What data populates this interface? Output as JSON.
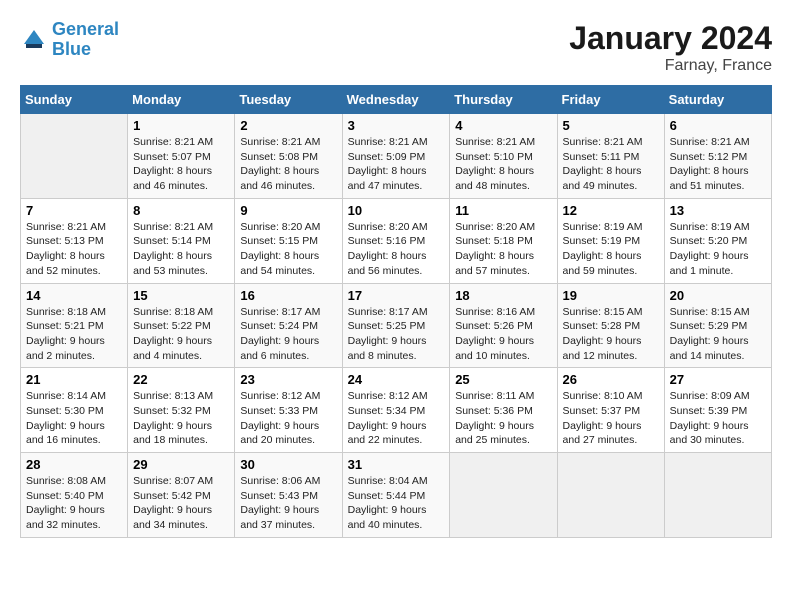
{
  "header": {
    "logo_line1": "General",
    "logo_line2": "Blue",
    "title": "January 2024",
    "subtitle": "Farnay, France"
  },
  "columns": [
    "Sunday",
    "Monday",
    "Tuesday",
    "Wednesday",
    "Thursday",
    "Friday",
    "Saturday"
  ],
  "weeks": [
    [
      {
        "day": "",
        "sunrise": "",
        "sunset": "",
        "daylight": ""
      },
      {
        "day": "1",
        "sunrise": "Sunrise: 8:21 AM",
        "sunset": "Sunset: 5:07 PM",
        "daylight": "Daylight: 8 hours and 46 minutes."
      },
      {
        "day": "2",
        "sunrise": "Sunrise: 8:21 AM",
        "sunset": "Sunset: 5:08 PM",
        "daylight": "Daylight: 8 hours and 46 minutes."
      },
      {
        "day": "3",
        "sunrise": "Sunrise: 8:21 AM",
        "sunset": "Sunset: 5:09 PM",
        "daylight": "Daylight: 8 hours and 47 minutes."
      },
      {
        "day": "4",
        "sunrise": "Sunrise: 8:21 AM",
        "sunset": "Sunset: 5:10 PM",
        "daylight": "Daylight: 8 hours and 48 minutes."
      },
      {
        "day": "5",
        "sunrise": "Sunrise: 8:21 AM",
        "sunset": "Sunset: 5:11 PM",
        "daylight": "Daylight: 8 hours and 49 minutes."
      },
      {
        "day": "6",
        "sunrise": "Sunrise: 8:21 AM",
        "sunset": "Sunset: 5:12 PM",
        "daylight": "Daylight: 8 hours and 51 minutes."
      }
    ],
    [
      {
        "day": "7",
        "sunrise": "Sunrise: 8:21 AM",
        "sunset": "Sunset: 5:13 PM",
        "daylight": "Daylight: 8 hours and 52 minutes."
      },
      {
        "day": "8",
        "sunrise": "Sunrise: 8:21 AM",
        "sunset": "Sunset: 5:14 PM",
        "daylight": "Daylight: 8 hours and 53 minutes."
      },
      {
        "day": "9",
        "sunrise": "Sunrise: 8:20 AM",
        "sunset": "Sunset: 5:15 PM",
        "daylight": "Daylight: 8 hours and 54 minutes."
      },
      {
        "day": "10",
        "sunrise": "Sunrise: 8:20 AM",
        "sunset": "Sunset: 5:16 PM",
        "daylight": "Daylight: 8 hours and 56 minutes."
      },
      {
        "day": "11",
        "sunrise": "Sunrise: 8:20 AM",
        "sunset": "Sunset: 5:18 PM",
        "daylight": "Daylight: 8 hours and 57 minutes."
      },
      {
        "day": "12",
        "sunrise": "Sunrise: 8:19 AM",
        "sunset": "Sunset: 5:19 PM",
        "daylight": "Daylight: 8 hours and 59 minutes."
      },
      {
        "day": "13",
        "sunrise": "Sunrise: 8:19 AM",
        "sunset": "Sunset: 5:20 PM",
        "daylight": "Daylight: 9 hours and 1 minute."
      }
    ],
    [
      {
        "day": "14",
        "sunrise": "Sunrise: 8:18 AM",
        "sunset": "Sunset: 5:21 PM",
        "daylight": "Daylight: 9 hours and 2 minutes."
      },
      {
        "day": "15",
        "sunrise": "Sunrise: 8:18 AM",
        "sunset": "Sunset: 5:22 PM",
        "daylight": "Daylight: 9 hours and 4 minutes."
      },
      {
        "day": "16",
        "sunrise": "Sunrise: 8:17 AM",
        "sunset": "Sunset: 5:24 PM",
        "daylight": "Daylight: 9 hours and 6 minutes."
      },
      {
        "day": "17",
        "sunrise": "Sunrise: 8:17 AM",
        "sunset": "Sunset: 5:25 PM",
        "daylight": "Daylight: 9 hours and 8 minutes."
      },
      {
        "day": "18",
        "sunrise": "Sunrise: 8:16 AM",
        "sunset": "Sunset: 5:26 PM",
        "daylight": "Daylight: 9 hours and 10 minutes."
      },
      {
        "day": "19",
        "sunrise": "Sunrise: 8:15 AM",
        "sunset": "Sunset: 5:28 PM",
        "daylight": "Daylight: 9 hours and 12 minutes."
      },
      {
        "day": "20",
        "sunrise": "Sunrise: 8:15 AM",
        "sunset": "Sunset: 5:29 PM",
        "daylight": "Daylight: 9 hours and 14 minutes."
      }
    ],
    [
      {
        "day": "21",
        "sunrise": "Sunrise: 8:14 AM",
        "sunset": "Sunset: 5:30 PM",
        "daylight": "Daylight: 9 hours and 16 minutes."
      },
      {
        "day": "22",
        "sunrise": "Sunrise: 8:13 AM",
        "sunset": "Sunset: 5:32 PM",
        "daylight": "Daylight: 9 hours and 18 minutes."
      },
      {
        "day": "23",
        "sunrise": "Sunrise: 8:12 AM",
        "sunset": "Sunset: 5:33 PM",
        "daylight": "Daylight: 9 hours and 20 minutes."
      },
      {
        "day": "24",
        "sunrise": "Sunrise: 8:12 AM",
        "sunset": "Sunset: 5:34 PM",
        "daylight": "Daylight: 9 hours and 22 minutes."
      },
      {
        "day": "25",
        "sunrise": "Sunrise: 8:11 AM",
        "sunset": "Sunset: 5:36 PM",
        "daylight": "Daylight: 9 hours and 25 minutes."
      },
      {
        "day": "26",
        "sunrise": "Sunrise: 8:10 AM",
        "sunset": "Sunset: 5:37 PM",
        "daylight": "Daylight: 9 hours and 27 minutes."
      },
      {
        "day": "27",
        "sunrise": "Sunrise: 8:09 AM",
        "sunset": "Sunset: 5:39 PM",
        "daylight": "Daylight: 9 hours and 30 minutes."
      }
    ],
    [
      {
        "day": "28",
        "sunrise": "Sunrise: 8:08 AM",
        "sunset": "Sunset: 5:40 PM",
        "daylight": "Daylight: 9 hours and 32 minutes."
      },
      {
        "day": "29",
        "sunrise": "Sunrise: 8:07 AM",
        "sunset": "Sunset: 5:42 PM",
        "daylight": "Daylight: 9 hours and 34 minutes."
      },
      {
        "day": "30",
        "sunrise": "Sunrise: 8:06 AM",
        "sunset": "Sunset: 5:43 PM",
        "daylight": "Daylight: 9 hours and 37 minutes."
      },
      {
        "day": "31",
        "sunrise": "Sunrise: 8:04 AM",
        "sunset": "Sunset: 5:44 PM",
        "daylight": "Daylight: 9 hours and 40 minutes."
      },
      {
        "day": "",
        "sunrise": "",
        "sunset": "",
        "daylight": ""
      },
      {
        "day": "",
        "sunrise": "",
        "sunset": "",
        "daylight": ""
      },
      {
        "day": "",
        "sunrise": "",
        "sunset": "",
        "daylight": ""
      }
    ]
  ]
}
